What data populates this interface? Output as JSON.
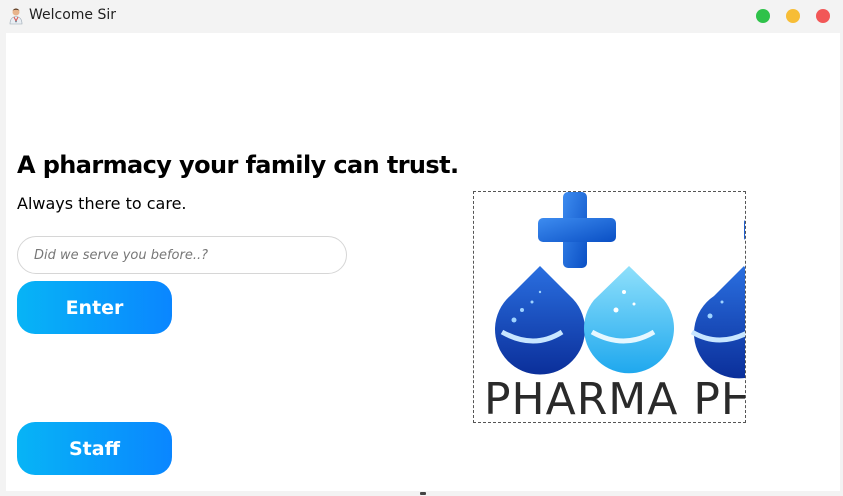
{
  "window": {
    "title": "Welcome Sir",
    "controls": [
      "maximize",
      "minimize",
      "close"
    ]
  },
  "colors": {
    "button_gradient_start": "#07b4f6",
    "button_gradient_end": "#0a86ff",
    "control_green": "#2fc24a",
    "control_yellow": "#f7bd36",
    "control_red": "#f25757"
  },
  "main": {
    "headline": "A pharmacy your family can trust.",
    "tagline": "Always there to care.",
    "search_placeholder": "Did we serve you before..?",
    "enter_label": "Enter",
    "staff_label": "Staff"
  },
  "logo": {
    "text": "PHARMA PH",
    "icons": [
      "medical-cross-icon",
      "water-drop-icon"
    ]
  }
}
